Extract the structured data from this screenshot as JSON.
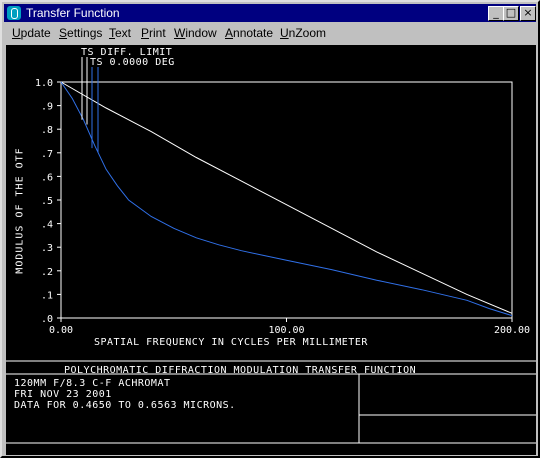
{
  "window": {
    "title": "Transfer Function",
    "min_glyph": "_",
    "max_glyph": "□",
    "close_glyph": "×"
  },
  "menu": [
    "Update",
    "Settings",
    "Text",
    "Print",
    "Window",
    "Annotate",
    "UnZoom"
  ],
  "plot": {
    "legend_line1": "TS DIFF. LIMIT",
    "legend_line2": "TS 0.0000 DEG",
    "ylabel": "MODULUS OF THE OTF",
    "xlabel": "SPATIAL FREQUENCY IN CYCLES PER MILLIMETER",
    "footer_title": "POLYCHROMATIC DIFFRACTION MODULATION TRANSFER FUNCTION",
    "info1": "120MM F/8.3  C-F ACHROMAT",
    "info2": "FRI NOV 23 2001",
    "info3": "DATA FOR 0.4650 TO 0.6563 MICRONS."
  },
  "chart_data": {
    "type": "line",
    "xlim": [
      0,
      200
    ],
    "ylim": [
      0,
      1
    ],
    "xticks": [
      "0.00",
      "100.00",
      "200.00"
    ],
    "yticks": [
      "1.0",
      ".9",
      ".8",
      ".7",
      ".6",
      ".5",
      ".4",
      ".3",
      ".2",
      ".1",
      ".0"
    ],
    "grid": false,
    "colors": {
      "limit": "#ffffff",
      "ts": "#3070e8"
    },
    "series": [
      {
        "name": "TS DIFF. LIMIT",
        "x": [
          0,
          20,
          40,
          60,
          80,
          100,
          120,
          140,
          160,
          180,
          200
        ],
        "y": [
          1.0,
          0.89,
          0.79,
          0.68,
          0.58,
          0.48,
          0.38,
          0.28,
          0.19,
          0.1,
          0.02
        ]
      },
      {
        "name": "TS 0.0000 DEG",
        "x": [
          0,
          5,
          10,
          15,
          20,
          25,
          30,
          40,
          50,
          60,
          70,
          80,
          90,
          100,
          120,
          140,
          160,
          180,
          190,
          200
        ],
        "y": [
          1.0,
          0.93,
          0.84,
          0.73,
          0.63,
          0.56,
          0.5,
          0.43,
          0.38,
          0.34,
          0.31,
          0.285,
          0.265,
          0.245,
          0.205,
          0.16,
          0.12,
          0.075,
          0.04,
          0.01
        ]
      }
    ]
  }
}
